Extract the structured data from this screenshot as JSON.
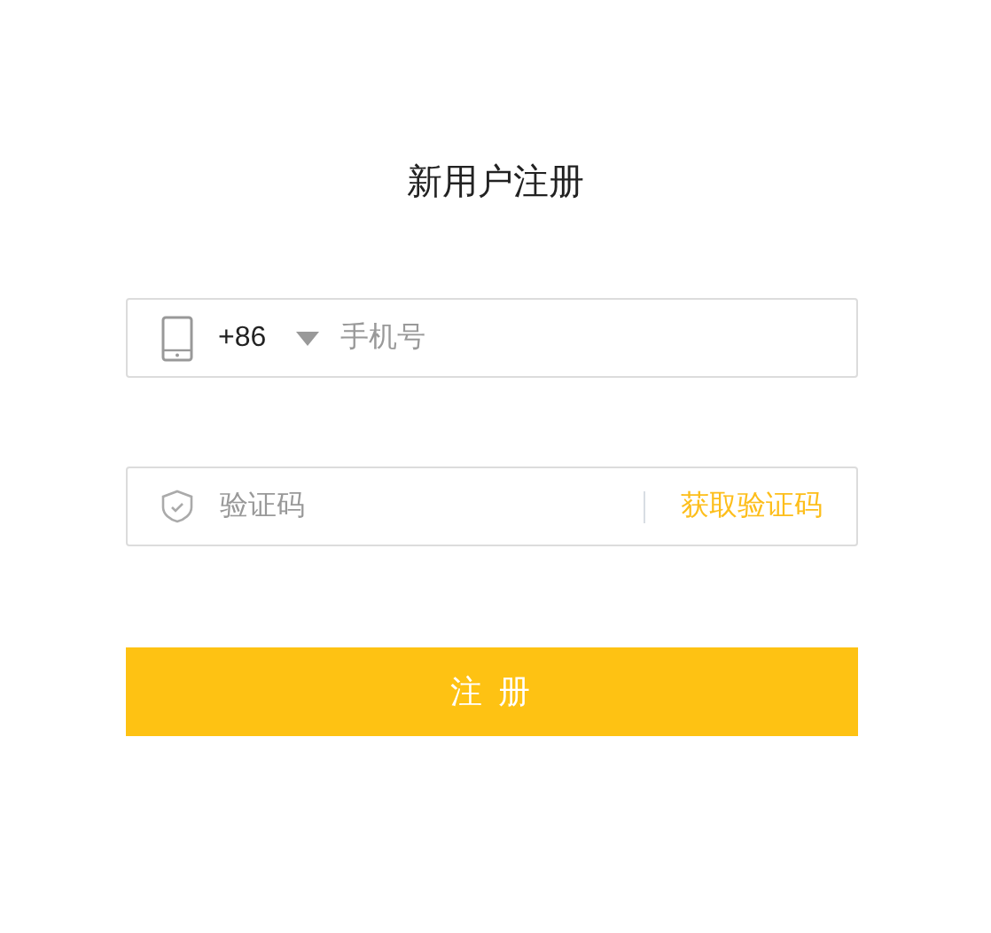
{
  "title": "新用户注册",
  "phone_field": {
    "country_code": "+86",
    "placeholder": "手机号"
  },
  "code_field": {
    "placeholder": "验证码",
    "action": "获取验证码"
  },
  "submit_button": "注 册"
}
